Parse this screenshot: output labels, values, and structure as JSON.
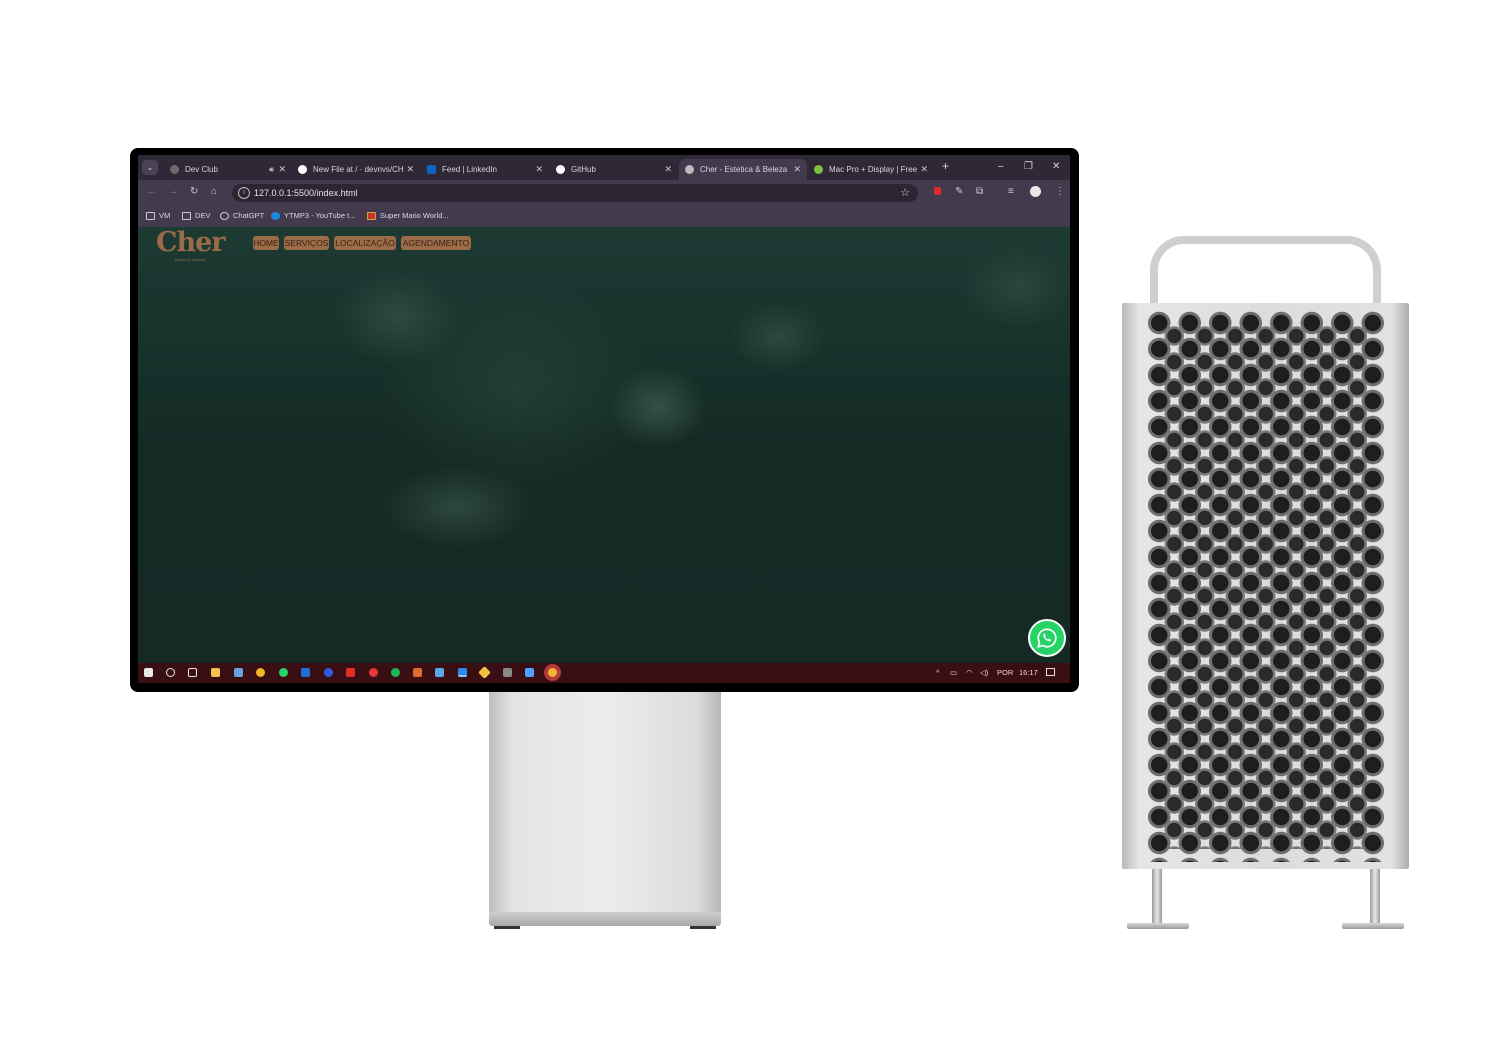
{
  "browser": {
    "tabs": [
      {
        "label": "Dev Club",
        "favicon_color": "#6b6b6b",
        "has_sound": true
      },
      {
        "label": "New File at / · devnvs/CHE",
        "favicon_color": "#ffffff"
      },
      {
        "label": "Feed | LinkedIn",
        "favicon_color": "#0a66c2"
      },
      {
        "label": "GitHub",
        "favicon_color": "#ffffff"
      },
      {
        "label": "Cher - Estetica & Beleza",
        "favicon_color": "#bdbdbd",
        "active": true
      },
      {
        "label": "Mac Pro + Display | Free c",
        "favicon_color": "#7cc23a"
      }
    ],
    "new_tab_label": "+",
    "window_controls": [
      "–",
      "❐",
      "✕"
    ],
    "url": "127.0.0.1:5500/index.html",
    "bookmarks": [
      {
        "label": "VM",
        "icon": "folder-icon"
      },
      {
        "label": "DEV",
        "icon": "folder-icon"
      },
      {
        "label": "ChatGPT",
        "icon": "chatgpt-icon"
      },
      {
        "label": "YTMP3 - YouTube t...",
        "icon": "ytmp3-icon"
      },
      {
        "label": "Super Mario World...",
        "icon": "mario-icon"
      }
    ]
  },
  "site": {
    "logo": "Cher",
    "logo_sub": "beleza & estética",
    "nav": [
      "HOME",
      "SERVIÇOS",
      "LOCALIZAÇÃO",
      "AGENDAMENTO"
    ],
    "accent": "#9c6b47"
  },
  "taskbar": {
    "tray_language": "POR",
    "clock": "16:17"
  }
}
